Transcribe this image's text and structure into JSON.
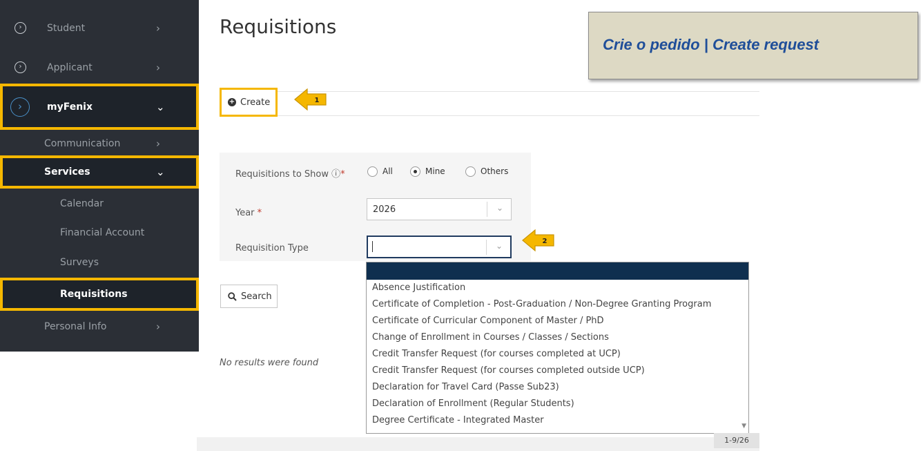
{
  "sidebar": {
    "items": [
      {
        "label": "Student",
        "chevron": "›"
      },
      {
        "label": "Applicant",
        "chevron": "›"
      },
      {
        "label": "myFenix",
        "chevron": "⌄"
      },
      {
        "label": "Communication",
        "chevron": "›"
      },
      {
        "label": "Services",
        "chevron": "⌄"
      },
      {
        "label": "Calendar"
      },
      {
        "label": "Financial Account"
      },
      {
        "label": "Surveys"
      },
      {
        "label": "Requisitions"
      },
      {
        "label": "Personal Info",
        "chevron": "›"
      }
    ],
    "colors": {
      "background": "#2b2f36",
      "highlight": "#f5b700"
    }
  },
  "main": {
    "title": "Requisitions",
    "callout": "Crie o pedido | Create request",
    "create_label": "Create",
    "arrows": [
      "1",
      "2"
    ],
    "form": {
      "show_label": "Requisitions to Show",
      "show_info_icon": "ⓘ",
      "required_mark": "*",
      "radio_options": [
        "All",
        "Mine",
        "Others"
      ],
      "radio_selected": "Mine",
      "year_label": "Year",
      "year_value": "2026",
      "type_label": "Requisition Type",
      "type_value": ""
    },
    "search_label": "Search",
    "no_results": "No results were found",
    "dropdown_options": [
      "Absence Justification",
      "Certificate of Completion - Post-Graduation / Non-Degree Granting Program",
      "Certificate of Curricular Component of Master / PhD",
      "Change of Enrollment in Courses / Classes / Sections",
      "Credit Transfer Request (for courses completed at UCP)",
      "Credit Transfer Request (for courses completed outside UCP)",
      "Declaration for Travel Card (Passe Sub23)",
      "Declaration of Enrollment (Regular Students)",
      "Degree Certificate - Integrated Master"
    ],
    "pager": "1-9/26"
  }
}
